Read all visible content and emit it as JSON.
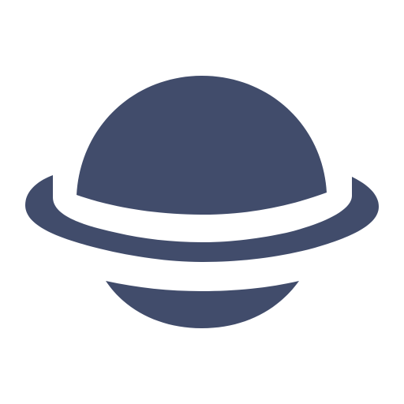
{
  "icon": {
    "name": "planet-icon",
    "color": "#414c6b",
    "background": "#ffffff"
  }
}
